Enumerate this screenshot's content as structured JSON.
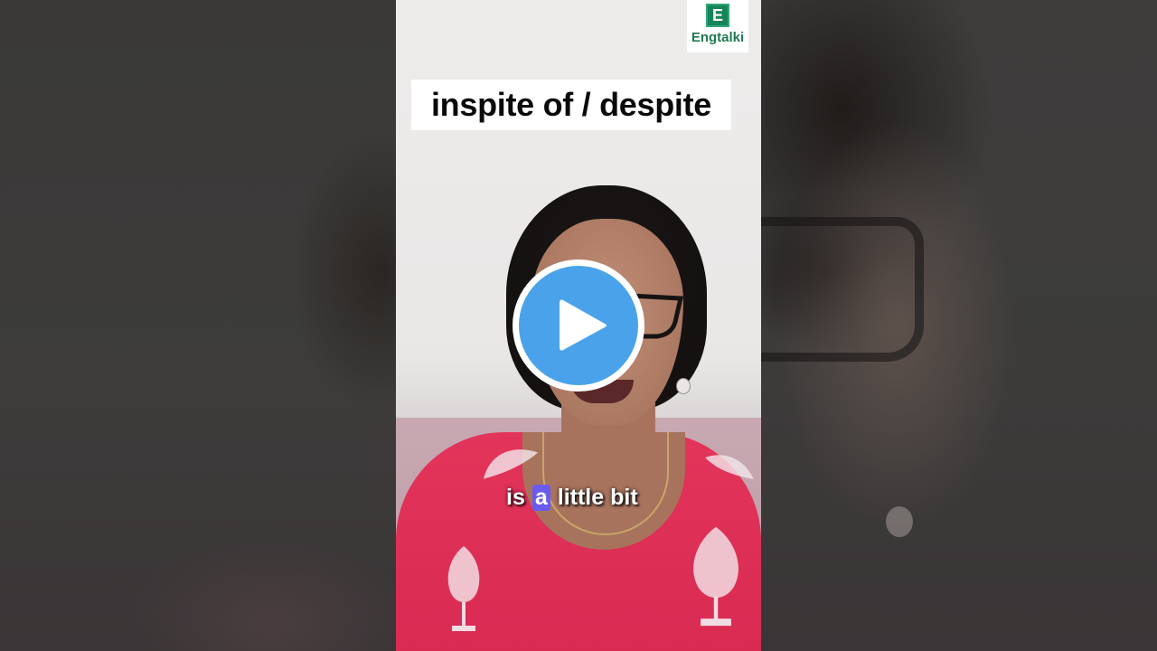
{
  "video": {
    "title_overlay": "inspite of / despite",
    "caption": {
      "words": [
        "is",
        "a",
        "little bit"
      ],
      "highlighted_word_index": 1,
      "highlight_color": "#6a5bf0"
    },
    "play_button_icon": "play-icon",
    "accent_color": "#4aa3ea"
  },
  "channel": {
    "logo_letter": "E",
    "logo_name": "Engtalki",
    "brand_color": "#18845a"
  }
}
